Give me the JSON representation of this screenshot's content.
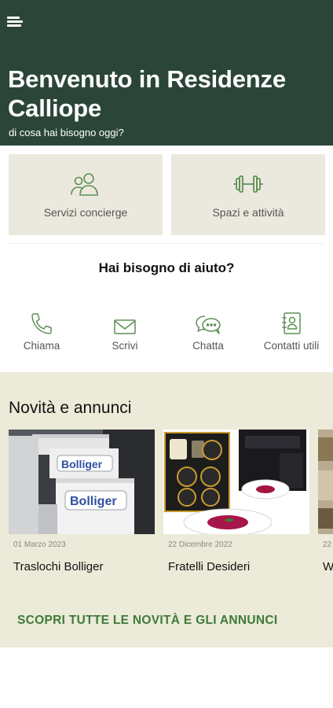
{
  "header": {
    "menu_icon": "hamburger-menu-icon",
    "title": "Benvenuto in Residenze Calliope",
    "subtitle": "di cosa hai bisogno oggi?",
    "background": "#2b4639"
  },
  "services": [
    {
      "label": "Servizi concierge",
      "icon": "people-icon"
    },
    {
      "label": "Spazi e attività",
      "icon": "dumbbell-icon"
    }
  ],
  "help": {
    "title": "Hai bisogno di aiuto?",
    "contacts": [
      {
        "label": "Chiama",
        "icon": "phone-icon"
      },
      {
        "label": "Scrivi",
        "icon": "envelope-icon"
      },
      {
        "label": "Chatta",
        "icon": "chat-icon"
      },
      {
        "label": "Contatti utili",
        "icon": "address-book-icon"
      }
    ]
  },
  "news": {
    "title": "Novità e annunci",
    "items": [
      {
        "date": "01 Marzo 2023",
        "title": "Traslochi Bolliger",
        "image_text": "Bolliger"
      },
      {
        "date": "22 Dicembre 2022",
        "title": "Fratelli Desideri",
        "image_text": ""
      },
      {
        "date": "22",
        "title": "W",
        "image_text": ""
      }
    ],
    "link": "SCOPRI TUTTE LE NOVITÀ E GLI ANNUNCI"
  },
  "colors": {
    "accent_green": "#3d7a38",
    "icon_green": "#5f8f56",
    "card_bg": "#ebe9dd",
    "news_bg": "#ecead8"
  }
}
